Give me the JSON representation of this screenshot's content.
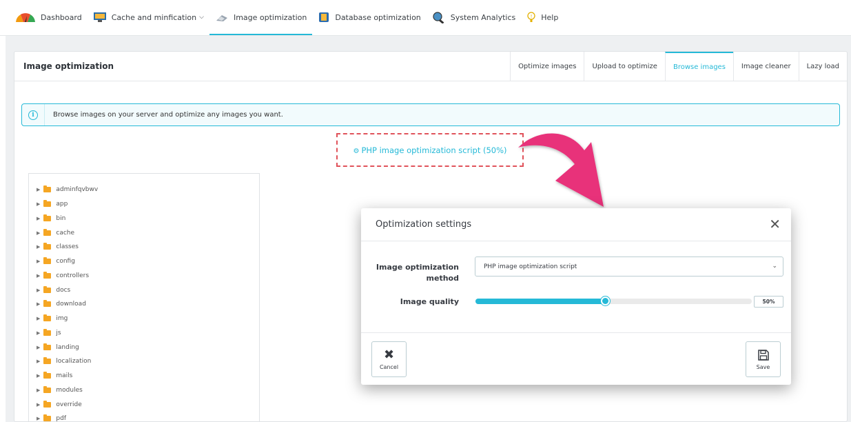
{
  "nav": {
    "items": [
      {
        "label": "Dashboard",
        "icon": "gauge-icon"
      },
      {
        "label": "Cache and minfication",
        "icon": "monitor-icon",
        "dropdown": true
      },
      {
        "label": "Image optimization",
        "icon": "image-tool-icon",
        "active": true
      },
      {
        "label": "Database optimization",
        "icon": "database-icon"
      },
      {
        "label": "System Analytics",
        "icon": "analytics-icon"
      },
      {
        "label": "Help",
        "icon": "help-icon"
      }
    ]
  },
  "panel": {
    "title": "Image optimization",
    "tabs": [
      {
        "label": "Optimize images"
      },
      {
        "label": "Upload to optimize"
      },
      {
        "label": "Browse images",
        "active": true
      },
      {
        "label": "Image cleaner"
      },
      {
        "label": "Lazy load"
      }
    ],
    "info_text": "Browse images on your server and optimize any images you want.",
    "method_link": "PHP image optimization script (50%)"
  },
  "tree": {
    "folders": [
      "adminfqvbwv",
      "app",
      "bin",
      "cache",
      "classes",
      "config",
      "controllers",
      "docs",
      "download",
      "img",
      "js",
      "landing",
      "localization",
      "mails",
      "modules",
      "override",
      "pdf"
    ]
  },
  "modal": {
    "title": "Optimization settings",
    "method_label_line1": "Image optimization",
    "method_label_line2": "method",
    "method_value": "PHP image optimization script",
    "quality_label": "Image quality",
    "quality_value": "50%",
    "quality_fraction": 0.47,
    "cancel_label": "Cancel",
    "save_label": "Save"
  },
  "colors": {
    "accent": "#25b9d7",
    "highlight_dashed": "#e0525a",
    "arrow": "#e8317a"
  }
}
